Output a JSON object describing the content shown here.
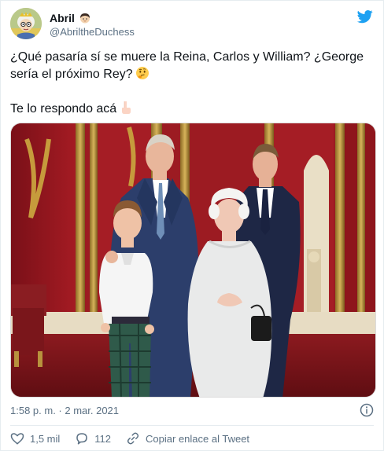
{
  "author": {
    "name": "Abril",
    "handle": "@AbriltheDuchess",
    "avatar_icon": "queen-cartoon-avatar",
    "name_emoji": "woman-emoji"
  },
  "tweet": {
    "line1": "¿Qué pasaría sí se muere la Reina, Carlos y William? ¿George sería el próximo Rey?",
    "line1_emoji": "thinking-face-emoji",
    "line2": "Te lo respondo acá",
    "line2_emoji": "backhand-index-pointing-down-emoji"
  },
  "media": {
    "icon": "royal-family-photo"
  },
  "meta": {
    "timestamp": "1:58 p. m. · 2 mar. 2021",
    "info_icon": "info-icon"
  },
  "actions": {
    "likes": "1,5 mil",
    "replies": "112",
    "copy_link": "Copiar enlace al Tweet"
  },
  "colors": {
    "twitter_blue": "#1da1f2",
    "secondary_text": "#5b7083",
    "primary_text": "#0f1419"
  }
}
